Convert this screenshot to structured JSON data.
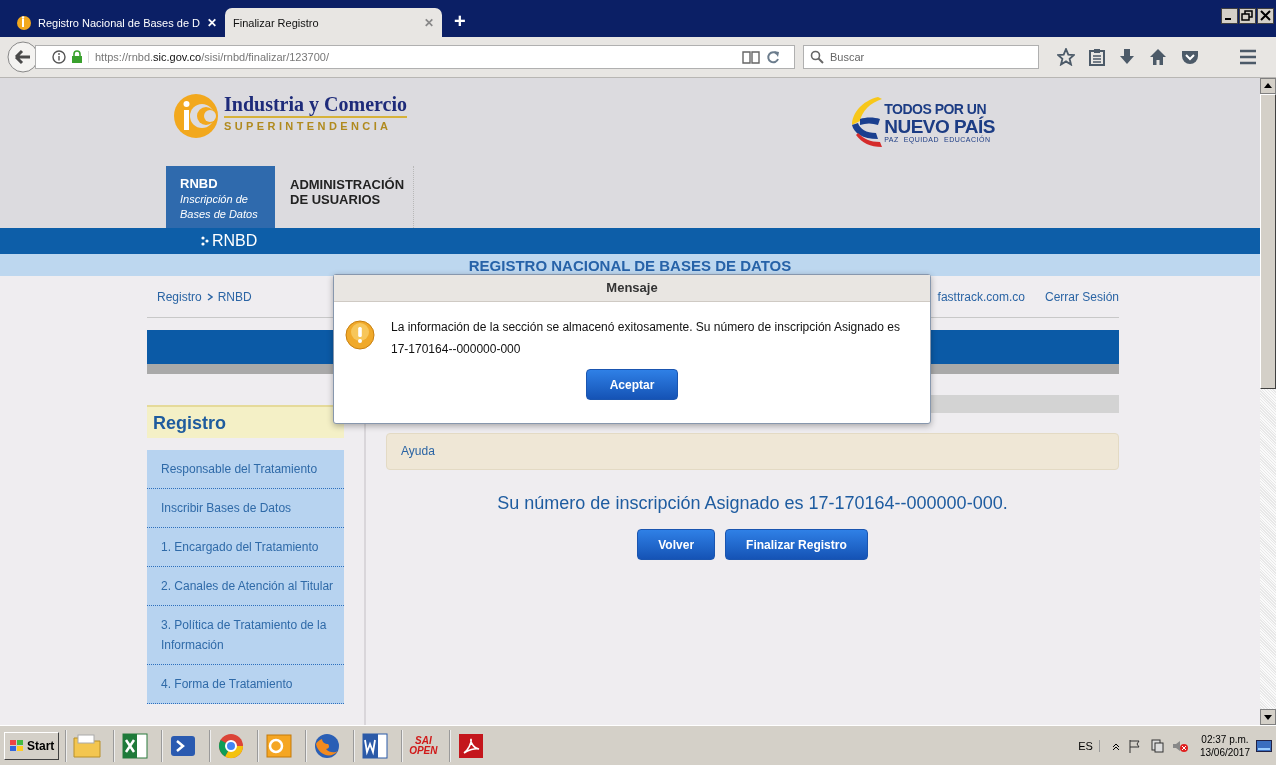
{
  "browser": {
    "tabs": [
      {
        "label": "Registro Nacional de Bases de D",
        "close": "✕",
        "selected": false
      },
      {
        "label": "Finalizar Registro",
        "close": "✕",
        "selected": true
      }
    ],
    "new_tab": "+",
    "url": {
      "scheme": "https://rnbd.",
      "domain": "sic.gov.co",
      "path": "/sisi/rnbd/finalizar/123700/"
    },
    "search": {
      "placeholder": "Buscar"
    }
  },
  "page": {
    "logo": {
      "title": "Industria y Comercio",
      "subtitle": "SUPERINTENDENCIA"
    },
    "campaign": {
      "line1": "TODOS POR UN",
      "line2": "NUEVO PAÍS",
      "tagline": "PAZ  EQUIDAD  EDUCACIÓN"
    },
    "nav": [
      {
        "title": "RNBD",
        "subtitle": "Inscripción de Bases de Datos",
        "selected": true
      },
      {
        "title": "ADMINISTRACIÓN DE USUARIOS",
        "selected": false
      }
    ],
    "section_bar": "RNBD",
    "heading": "REGISTRO NACIONAL DE BASES DE DATOS",
    "breadcrumb": [
      "Registro",
      "RNBD"
    ],
    "user": "fasttrack.com.co",
    "logout": "Cerrar Sesión",
    "sidebar": {
      "title": "Registro",
      "items": [
        "Responsable del Tratamiento",
        "Inscribir Bases de Datos",
        "1. Encargado del Tratamiento",
        "2. Canales de Atención al Titular",
        "3. Política de Tratamiento de la Información",
        "4. Forma de Tratamiento"
      ]
    },
    "help": "Ayuda",
    "message": "Su número de inscripción Asignado es 17-170164--000000-000.",
    "buttons": [
      "Volver",
      "Finalizar Registro"
    ]
  },
  "dialog": {
    "title": "Mensaje",
    "text": "La información de la sección se almacenó exitosamente. Su número de inscripción Asignado es 17-170164--000000-000",
    "button": "Aceptar"
  },
  "taskbar": {
    "start": "Start",
    "app_label": "SAI OPEN",
    "language": "ES",
    "time": "02:37 p.m.",
    "date": "13/06/2017"
  }
}
